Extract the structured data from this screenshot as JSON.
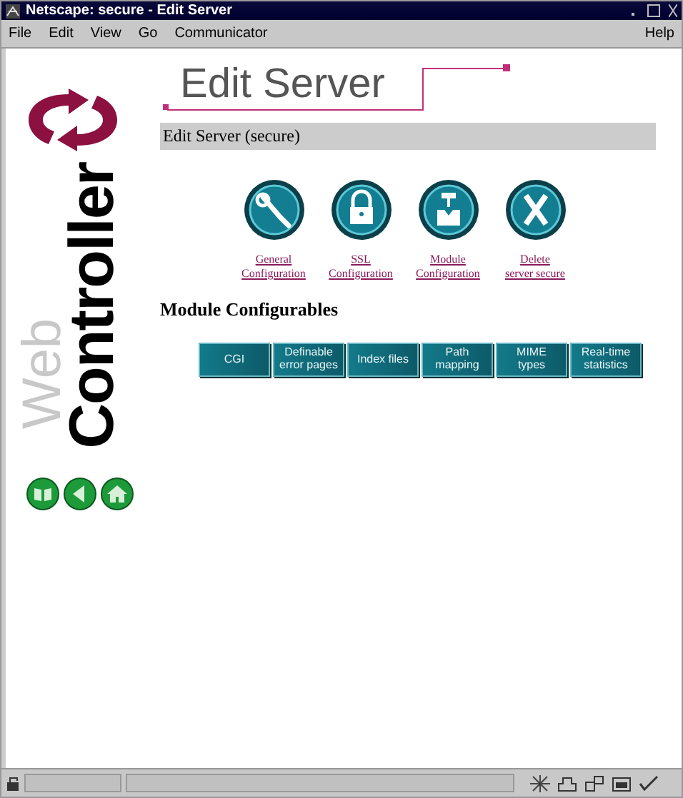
{
  "window": {
    "title": "Netscape: secure - Edit Server"
  },
  "menu": {
    "left": [
      "File",
      "Edit",
      "View",
      "Go",
      "Communicator"
    ],
    "right": "Help"
  },
  "sidebar": {
    "brand_light": "Web",
    "brand_bold": "Controller"
  },
  "page": {
    "heading": "Edit Server",
    "subheading": "Edit Server (secure)",
    "actions": [
      {
        "kind": "wrench",
        "line1": "General",
        "line2": "Configuration"
      },
      {
        "kind": "lock",
        "line1": "SSL",
        "line2": "Configuration"
      },
      {
        "kind": "module",
        "line1": "Module",
        "line2": "Configuration"
      },
      {
        "kind": "delete",
        "line1": "Delete",
        "line2": "server secure"
      }
    ],
    "section_title": "Module Configurables",
    "modules": [
      {
        "line1": "CGI"
      },
      {
        "line1": "Definable",
        "line2": "error pages"
      },
      {
        "line1": "Index files"
      },
      {
        "line1": "Path",
        "line2": "mapping"
      },
      {
        "line1": "MIME",
        "line2": "types"
      },
      {
        "line1": "Real-time",
        "line2": "statistics"
      }
    ]
  }
}
